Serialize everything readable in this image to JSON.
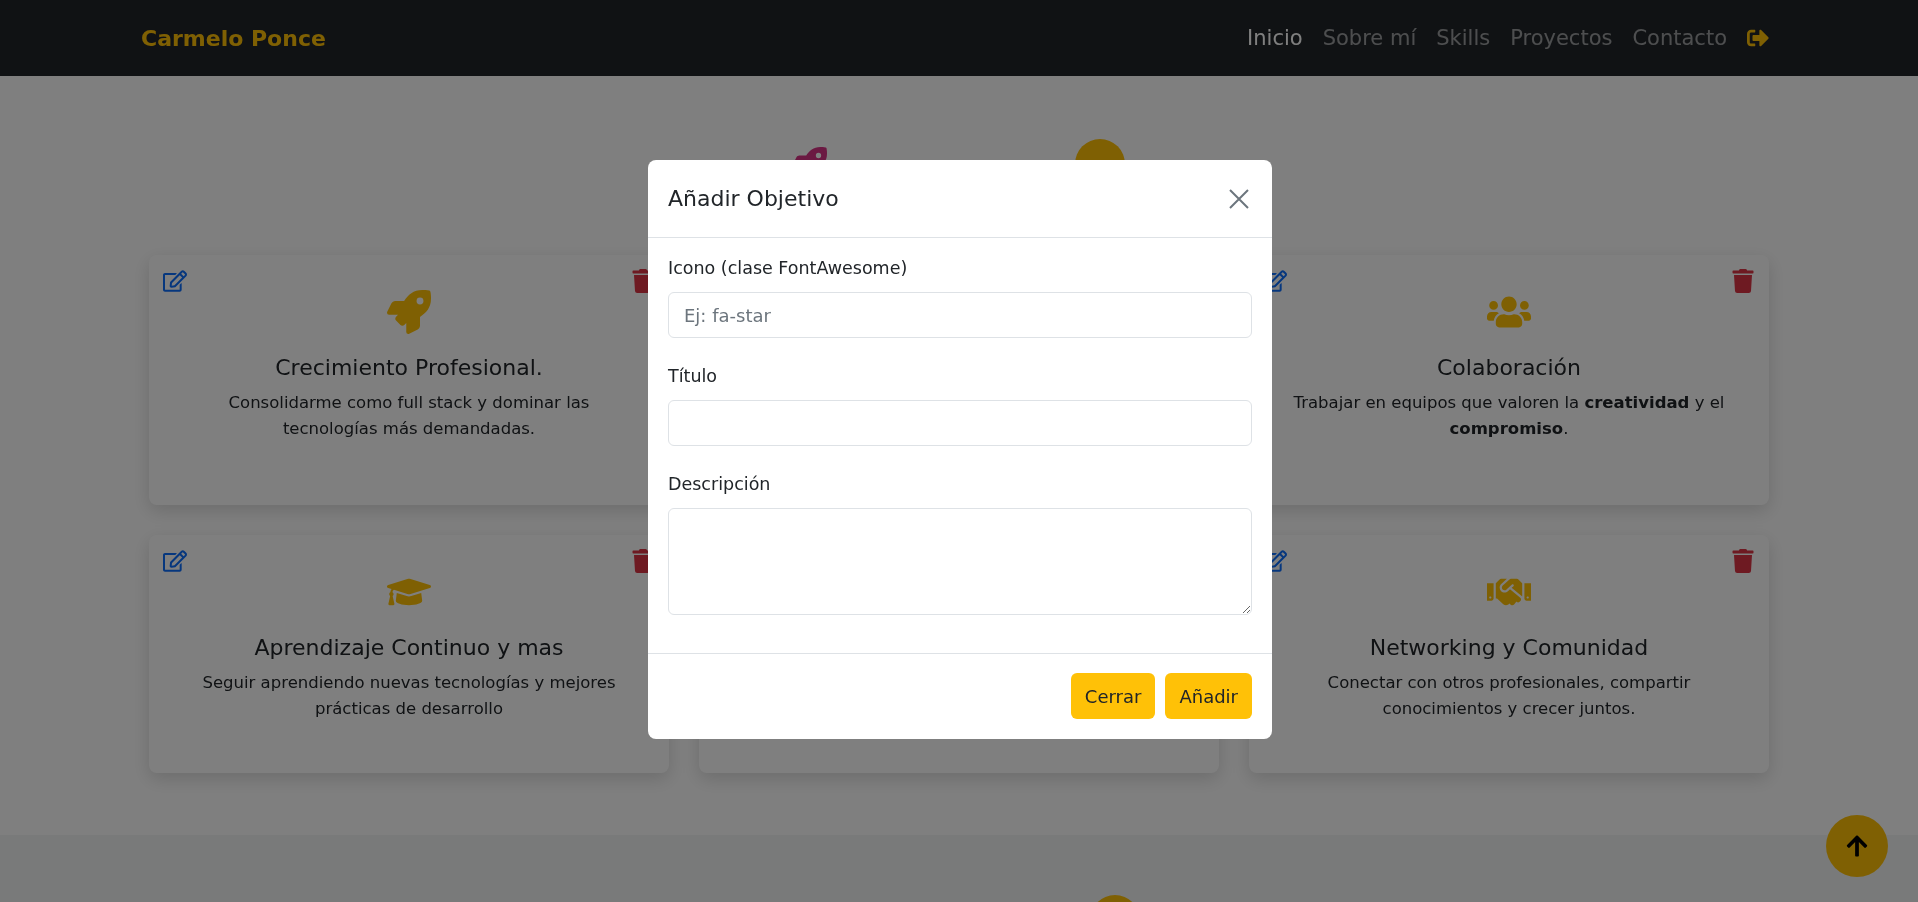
{
  "navbar": {
    "brand": "Carmelo Ponce",
    "links": [
      {
        "label": "Inicio",
        "selected": true
      },
      {
        "label": "Sobre mí",
        "selected": false
      },
      {
        "label": "Skills",
        "selected": false
      },
      {
        "label": "Proyectos",
        "selected": false
      },
      {
        "label": "Contacto",
        "selected": false
      }
    ]
  },
  "card_rows": [
    {
      "left": {
        "title": "Crecimiento Profesional.",
        "description": "Consolidarme como full stack y dominar las tecnologías más demandadas."
      },
      "right": {
        "title": "Colaboración",
        "description": "Trabajar en equipos que valoren la **creatividad** y el **compromiso**."
      }
    },
    {
      "left": {
        "title": "Aprendizaje Continuo y mas",
        "description": "Seguir aprendiendo nuevas tecnologías y mejores prácticas de desarrollo"
      },
      "right": {
        "title": "Networking y Comunidad",
        "description": "Conectar con otros profesionales, compartir conocimientos y crecer juntos."
      }
    }
  ],
  "modal": {
    "title": "Añadir Objetivo",
    "fields": [
      {
        "kind": "input",
        "label": "Icono (clase FontAwesome)",
        "placeholder": "Ej: fa-star"
      },
      {
        "kind": "input",
        "label": "Título"
      },
      {
        "kind": "textarea",
        "label": "Descripción"
      }
    ],
    "buttons": [
      "Cerrar",
      "Añadir"
    ]
  }
}
